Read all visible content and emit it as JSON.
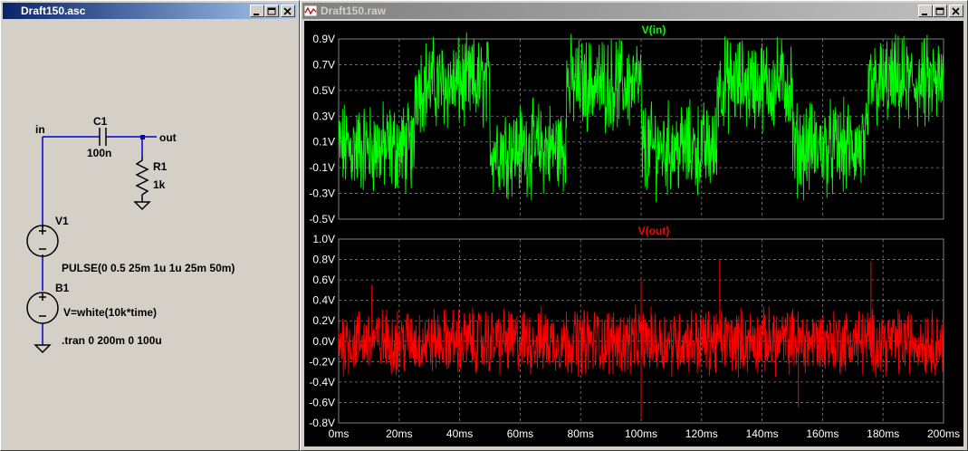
{
  "schematic_window": {
    "title": "Draft150.asc",
    "labels": {
      "net_in": "in",
      "net_out": "out",
      "c1_name": "C1",
      "c1_value": "100n",
      "r1_name": "R1",
      "r1_value": "1k",
      "v1_name": "V1",
      "v1_value": "PULSE(0 0.5 25m 1u 1u 25m 50m)",
      "b1_name": "B1",
      "b1_value": "V=white(10k*time)",
      "directive": ".tran 0 200m 0 100u"
    }
  },
  "waveform_window": {
    "title": "Draft150.raw"
  },
  "colors": {
    "vin_trace": "#00ff00",
    "vout_trace": "#ff0000",
    "wire": "#0000cc",
    "grid": "#808080",
    "axis_text": "#ffffff"
  },
  "chart_data": [
    {
      "type": "line",
      "title": "V(in)",
      "series": [
        {
          "name": "V(in)",
          "color": "#00ff00"
        }
      ],
      "x": {
        "min": 0,
        "max": 200,
        "unit": "ms",
        "ticks": [
          "0ms",
          "20ms",
          "40ms",
          "60ms",
          "80ms",
          "100ms",
          "120ms",
          "140ms",
          "160ms",
          "180ms",
          "200ms"
        ]
      },
      "ylim": [
        -0.5,
        0.9
      ],
      "y_ticks": [
        "0.9V",
        "0.7V",
        "0.5V",
        "0.3V",
        "0.1V",
        "-0.1V",
        "-0.3V",
        "-0.5V"
      ],
      "y_tick_values": [
        0.9,
        0.7,
        0.5,
        0.3,
        0.1,
        -0.1,
        -0.3,
        -0.5
      ],
      "segments": [
        {
          "x_start": 0,
          "x_end": 25,
          "center": 0.05,
          "noise_low": -0.45,
          "noise_high": 0.45
        },
        {
          "x_start": 25,
          "x_end": 50,
          "center": 0.55,
          "noise_low": 0.05,
          "noise_high": 0.95
        },
        {
          "x_start": 50,
          "x_end": 75,
          "center": 0.05,
          "noise_low": -0.45,
          "noise_high": 0.45
        },
        {
          "x_start": 75,
          "x_end": 100,
          "center": 0.55,
          "noise_low": 0.05,
          "noise_high": 0.95
        },
        {
          "x_start": 100,
          "x_end": 125,
          "center": 0.05,
          "noise_low": -0.45,
          "noise_high": 0.45
        },
        {
          "x_start": 125,
          "x_end": 150,
          "center": 0.55,
          "noise_low": 0.05,
          "noise_high": 0.95
        },
        {
          "x_start": 150,
          "x_end": 175,
          "center": 0.05,
          "noise_low": -0.45,
          "noise_high": 0.45
        },
        {
          "x_start": 175,
          "x_end": 200,
          "center": 0.55,
          "noise_low": 0.05,
          "noise_high": 0.95
        }
      ],
      "grid": true
    },
    {
      "type": "line",
      "title": "V(out)",
      "series": [
        {
          "name": "V(out)",
          "color": "#ff0000"
        }
      ],
      "x": {
        "min": 0,
        "max": 200,
        "unit": "ms",
        "ticks": [
          "0ms",
          "20ms",
          "40ms",
          "60ms",
          "80ms",
          "100ms",
          "120ms",
          "140ms",
          "160ms",
          "180ms",
          "200ms"
        ]
      },
      "ylim": [
        -0.8,
        1.0
      ],
      "y_ticks": [
        "1.0V",
        "0.8V",
        "0.6V",
        "0.4V",
        "0.2V",
        "0.0V",
        "-0.2V",
        "-0.4V",
        "-0.6V",
        "-0.8V"
      ],
      "y_tick_values": [
        1.0,
        0.8,
        0.6,
        0.4,
        0.2,
        0.0,
        -0.2,
        -0.4,
        -0.6,
        -0.8
      ],
      "noise_band": {
        "center": 0.0,
        "typical_low": -0.3,
        "typical_high": 0.3
      },
      "spikes": [
        {
          "x": 100,
          "y": 0.6
        },
        {
          "x": 100,
          "y": -0.75
        },
        {
          "x": 126,
          "y": 0.8
        },
        {
          "x": 152,
          "y": -0.65
        },
        {
          "x": 176,
          "y": 0.78
        },
        {
          "x": 11,
          "y": 0.55
        }
      ],
      "grid": true
    }
  ]
}
